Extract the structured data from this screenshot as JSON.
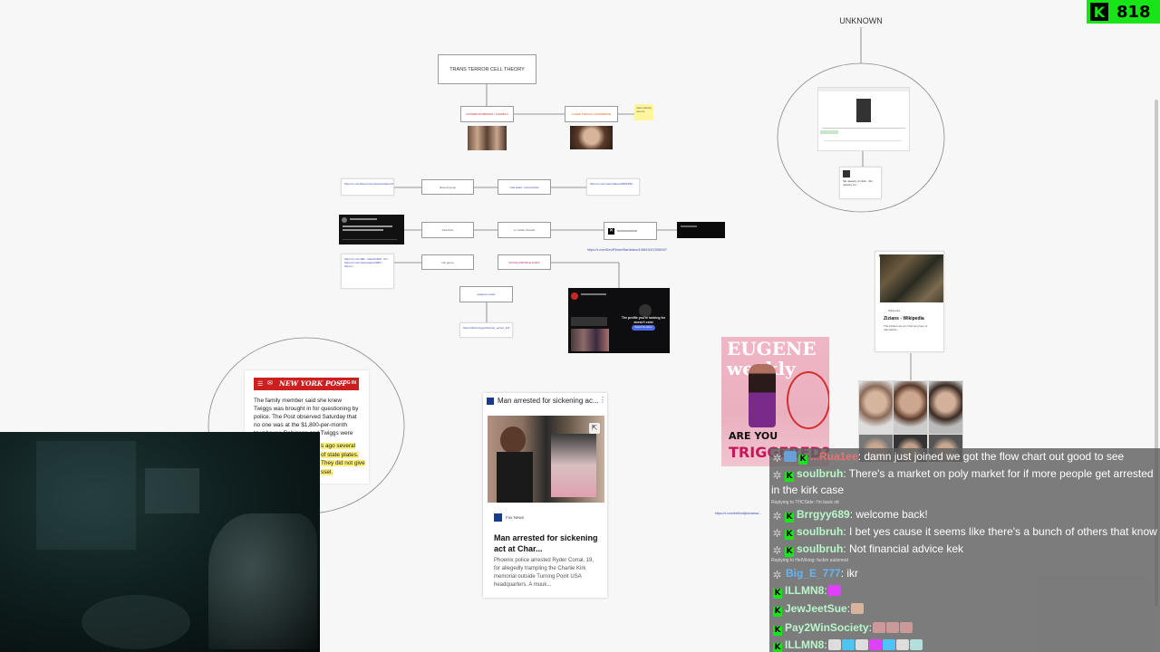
{
  "board": {
    "unknown_label": "UNKNOWN",
    "theory_title": "TRANS TERROR CELL THEORY",
    "node_left_top": "CONNOR ROBINSON / SUSPECT",
    "node_right_top": "LANCE TWIGGS / ROOMMATE",
    "sticky_note": "trans identity rumors",
    "node_mid_a": "discord group",
    "node_mid_b": "chat leaks / screenshots",
    "node_row2_a": "dark links",
    "node_row2_b": "X / twitter threads",
    "node_row3_a": "link group",
    "node_row3_b": "SOCIAL PROFILE LINKS",
    "node_row4": "telegram posts",
    "link_card_1": "https://x.com/theconnornetwork/status/1966182011",
    "link_card_2": "https://x.com/user/status/19661840...",
    "link_card_3": "https://x.com/d6k...status/1966...22 / https://x.com/user/status/1966 / https://...",
    "link_card_4": "https://discord.gg/robinson_server_link",
    "url_under_x": "https://x.com/DevilFlowerStar/status/1966190472080007",
    "url_bottom_middle": "https://x.com/bbKindlyfo/status/...",
    "x_embed_caption": "The profile you're looking for doesn't exist",
    "x_embed_button": "Search for others",
    "wiki_title": "Zizians - Wikipedia",
    "wiki_source": "Wikipedia",
    "wiki_snippet": "The Zizians are an informal group of rationalists...",
    "unknown_card_title": "Ski Jewelry of Utah - Ski Jewelry Co..",
    "magazine_masthead": "EUGENE weekly",
    "magazine_line1": "ARE YOU",
    "magazine_line2": "TRIGGERED?"
  },
  "nypost": {
    "logo": "NEW YORK POST",
    "login": "LOG IN",
    "body": "The family member said she knew Twiggs was brought in for questioning by police. The Post observed Saturday that no one was at the $1,800-per-month townhouse Robinson and Twiggs were believed to have shared.",
    "highlight1": "s ago several",
    "highlight2": "of state plates.",
    "highlight3": "They did not give",
    "highlight4": "ssel."
  },
  "news_card": {
    "header": "Man arrested for sickening ac...",
    "source": "Fox News",
    "title": "Man arrested for sickening act at Char...",
    "snippet": "Phoenix police arrested Ryder Corral, 19, for allegedly trampling the Charlie Kirk memorial outside Turning Point USA headquarters. A muuk..."
  },
  "viewer_count": "818",
  "chat": {
    "m1_user": "...Rua1ee",
    "m1_text": ": damn just joined we got the flow chart out good to see",
    "m2_user": "soulbruh",
    "m2_text": ": There's a market on poly market for if more people get arrested in the kirk case",
    "r1": "Replying to THCSide: I'm back ott",
    "m3_user": "Brrgyy689",
    "m3_text": ": welcome back!",
    "m4_user": "soulbruh",
    "m4_text": ": I bet yes cause it seems like there's a bunch of others that know",
    "m5_user": "soulbruh",
    "m5_text": ": Not financial advice kek",
    "r2": "Replying to HelViking: fuckin autismod",
    "m6_user": "Big_E_777",
    "m6_text": ": ikr",
    "m7_user": "ILLMN8",
    "m7_text": ":",
    "m8_user": "JewJeetSue",
    "m8_text": ":",
    "m9_user": "Pay2WinSociety",
    "m9_text": ":",
    "m10_user": "ILLMN8",
    "m10_text": ":"
  },
  "colors": {
    "kick_green": "#18e518",
    "nypost_red": "#cc1f1f",
    "link_blue": "#3949ab"
  }
}
